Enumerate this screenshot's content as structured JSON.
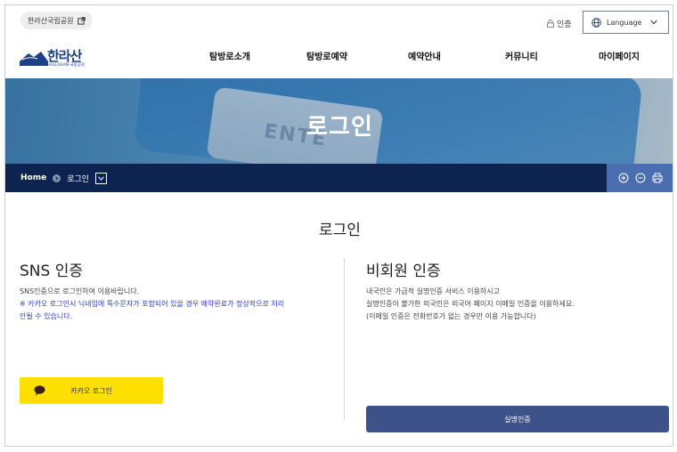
{
  "topbar": {
    "park_link": "한라산국립공원",
    "cert_link": "인증",
    "language_label": "Language"
  },
  "logo": {
    "name": "한라산",
    "sub": "HALLASAN 국립공원"
  },
  "nav": {
    "items": [
      "탐방로소개",
      "탐방로예약",
      "예약안내",
      "커뮤니티",
      "마이페이지"
    ]
  },
  "hero": {
    "title": "로그인",
    "background_text": "ENTE"
  },
  "breadcrumb": {
    "home": "Home",
    "current": "로그인"
  },
  "main": {
    "heading": "로그인",
    "sns": {
      "title": "SNS 인증",
      "desc": "SNS인증으로 로그인하여 이용바랍니다.",
      "notice_1": "※ 카카오 로그인시 닉네임에 특수문자가 포함되어 있을 경우 예약완료가 정상적으로 처리",
      "notice_2": "안될 수 있습니다.",
      "kakao_button": "카카오 로그인"
    },
    "guest": {
      "title": "비회원 인증",
      "line_1": "내국인은 가급적 실명인증 서비스 이용하시고",
      "line_2": "실명인증이 불가한 외국인은 외국어 페이지 이메일 인증을 이용하세요.",
      "line_3": "(이메일 인증은 전화번호가 없는 경우만 이용 가능합니다)",
      "verify_button": "실명인증"
    }
  },
  "colors": {
    "navy": "#0d2451",
    "tools_blue": "#4b6eb0",
    "kakao_yellow": "#fde000",
    "verify_blue": "#3c5288",
    "notice_blue": "#2f3fb8"
  },
  "icons": [
    "external-link-icon",
    "lock-icon",
    "globe-icon",
    "chevron-down-icon",
    "zoom-in-icon",
    "zoom-out-icon",
    "print-icon",
    "speech-bubble-icon"
  ]
}
